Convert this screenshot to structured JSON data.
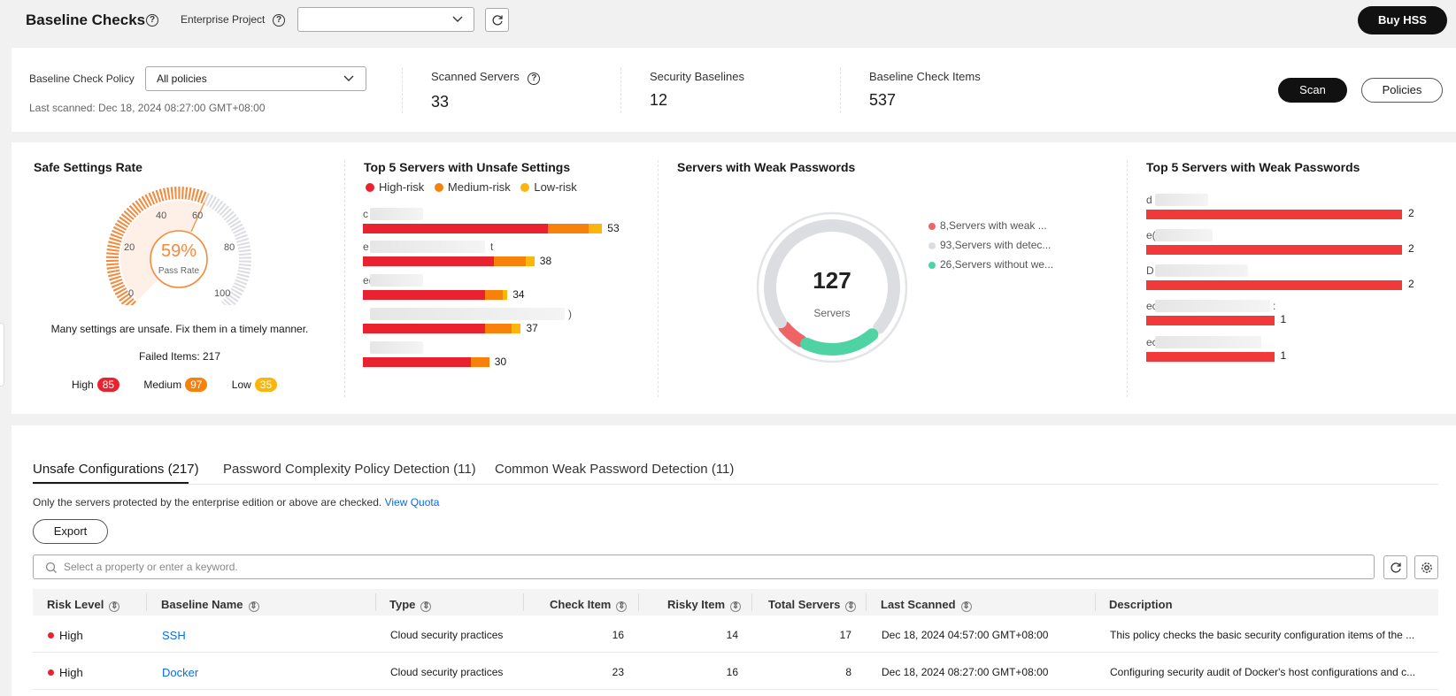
{
  "header": {
    "title": "Baseline Checks",
    "enterprise_label": "Enterprise Project",
    "enterprise_value": "",
    "buy_label": "Buy HSS"
  },
  "policy": {
    "label": "Baseline Check Policy",
    "value": "All policies",
    "last_scanned": "Last scanned: Dec 18, 2024 08:27:00 GMT+08:00"
  },
  "stats": [
    {
      "label": "Scanned Servers",
      "value": "33"
    },
    {
      "label": "Security Baselines",
      "value": "12"
    },
    {
      "label": "Baseline Check Items",
      "value": "537"
    }
  ],
  "actions": {
    "scan": "Scan",
    "policies": "Policies"
  },
  "safe_rate": {
    "title": "Safe Settings Rate",
    "percent": "59%",
    "percent_value": 59,
    "caption": "Pass Rate",
    "ticks": [
      "0",
      "20",
      "40",
      "60",
      "80",
      "100"
    ],
    "message": "Many settings are unsafe. Fix them in a timely manner.",
    "failed": "Failed Items: 217",
    "levels": [
      {
        "label": "High",
        "count": "85",
        "color": "#e8232f"
      },
      {
        "label": "Medium",
        "count": "97",
        "color": "#f7810b"
      },
      {
        "label": "Low",
        "count": "35",
        "color": "#fbb50c"
      }
    ]
  },
  "top_unsafe": {
    "title": "Top 5 Servers with Unsafe Settings",
    "legend": [
      {
        "label": "High-risk",
        "color": "#e8232f"
      },
      {
        "label": "Medium-risk",
        "color": "#f7810b"
      },
      {
        "label": "Low-risk",
        "color": "#fbb50c"
      }
    ],
    "servers": [
      {
        "name": "c",
        "total": "53",
        "high": 41,
        "medium": 9,
        "low": 3
      },
      {
        "name": "e",
        "name_end": "t",
        "total": "38",
        "high": 29,
        "medium": 7,
        "low": 2
      },
      {
        "name": "e(",
        "total": "34",
        "high": 27,
        "medium": 4,
        "low": 1
      },
      {
        "name": "",
        "name_end": ")",
        "total": "37",
        "high": 27,
        "medium": 6,
        "low": 2
      },
      {
        "name": "",
        "total": "30",
        "high": 24,
        "medium": 4,
        "low": 0
      }
    ]
  },
  "weak_pw": {
    "title": "Servers with Weak Passwords",
    "total": "127",
    "caption": "Servers",
    "items": [
      {
        "label": "8,Servers with weak ...",
        "value": 8,
        "color": "#ef6464"
      },
      {
        "label": "93,Servers with detec...",
        "value": 93,
        "color": "#dcdde1"
      },
      {
        "label": "26,Servers without we...",
        "value": 26,
        "color": "#4fd2a4"
      }
    ]
  },
  "top_weak": {
    "title": "Top 5 Servers with Weak Passwords",
    "servers": [
      {
        "name": "d",
        "value": "2"
      },
      {
        "name": "e(",
        "value": "2"
      },
      {
        "name": "D",
        "value": "2"
      },
      {
        "name": "ec",
        "name_end": ":",
        "value": "1"
      },
      {
        "name": "ec",
        "value": "1"
      }
    ]
  },
  "tabs": [
    {
      "label": "Unsafe Configurations (217)"
    },
    {
      "label": "Password Complexity Policy Detection (11)"
    },
    {
      "label": "Common Weak Password Detection (11)"
    }
  ],
  "note": {
    "text": "Only the servers protected by the enterprise edition or above are checked.",
    "link": "View Quota"
  },
  "export_label": "Export",
  "search_placeholder": "Select a property or enter a keyword.",
  "table": {
    "headers": [
      "Risk Level",
      "Baseline Name",
      "Type",
      "Check Item",
      "Risky Item",
      "Total Servers",
      "Last Scanned",
      "Description"
    ],
    "rows": [
      {
        "risk": "High",
        "name": "SSH",
        "type": "Cloud security practices",
        "check": "16",
        "risky": "14",
        "total": "17",
        "scanned": "Dec 18, 2024 04:57:00 GMT+08:00",
        "desc": "This policy checks the basic security configuration items of the ..."
      },
      {
        "risk": "High",
        "name": "Docker",
        "type": "Cloud security practices",
        "check": "23",
        "risky": "16",
        "total": "8",
        "scanned": "Dec 18, 2024 08:27:00 GMT+08:00",
        "desc": "Configuring security audit of Docker's host configurations and c..."
      }
    ]
  }
}
